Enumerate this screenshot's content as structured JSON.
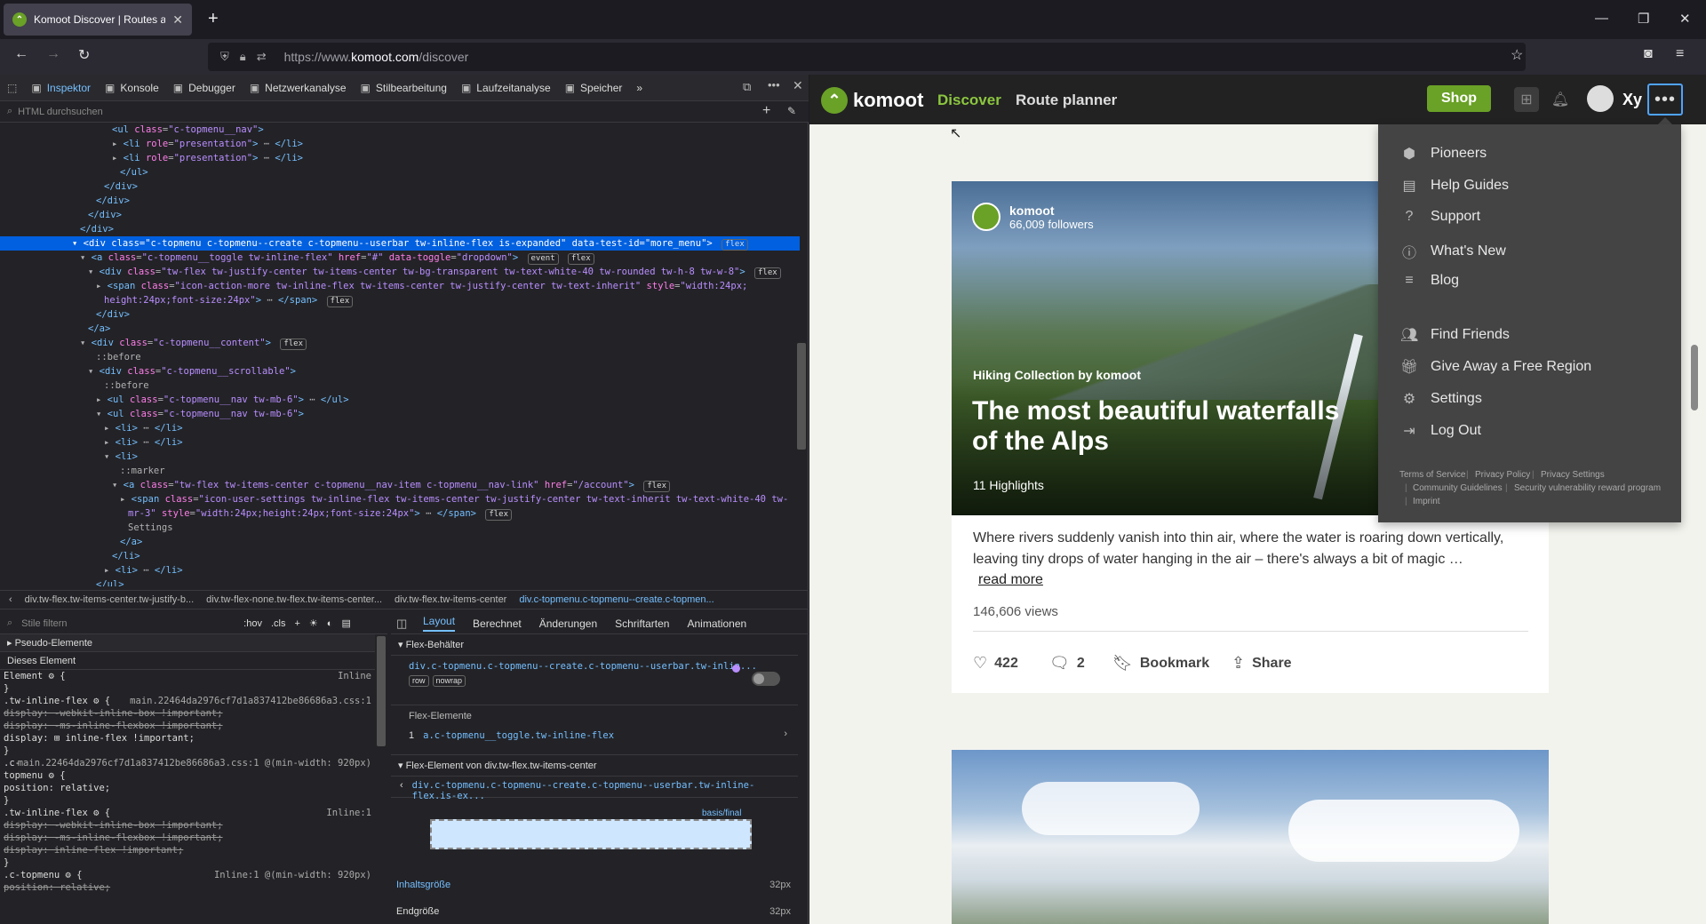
{
  "browser": {
    "tab_title": "Komoot Discover | Routes and M",
    "tab_close": "✕",
    "new_tab": "+",
    "url_prefix": "https://www.",
    "url_domain": "komoot.com",
    "url_path": "/discover",
    "window_controls": [
      "—",
      "❐",
      "✕"
    ]
  },
  "devtools": {
    "tabs": [
      {
        "label": "Inspektor",
        "icon": "inspector-icon",
        "active": true
      },
      {
        "label": "Konsole",
        "icon": "console-icon"
      },
      {
        "label": "Debugger",
        "icon": "debugger-icon"
      },
      {
        "label": "Netzwerkanalyse",
        "icon": "network-icon"
      },
      {
        "label": "Stilbearbeitung",
        "icon": "style-editor-icon"
      },
      {
        "label": "Laufzeitanalyse",
        "icon": "performance-icon"
      },
      {
        "label": "Speicher",
        "icon": "memory-icon"
      }
    ],
    "search_placeholder": "HTML durchsuchen",
    "markup_lines": [
      {
        "indent": 14,
        "html": "<span class='tg'>&lt;ul</span> <span class='an'>class</span>=<span class='av'>\"c-topmenu__nav\"</span><span class='tg'>&gt;</span>"
      },
      {
        "indent": 14,
        "html": "▸ <span class='tg'>&lt;li</span> <span class='an'>role</span>=<span class='av'>\"presentation\"</span><span class='tg'>&gt;</span> ⋯ <span class='tg'>&lt;/li&gt;</span>"
      },
      {
        "indent": 14,
        "html": "▸ <span class='tg'>&lt;li</span> <span class='an'>role</span>=<span class='av'>\"presentation\"</span><span class='tg'>&gt;</span> ⋯ <span class='tg'>&lt;/li&gt;</span>"
      },
      {
        "indent": 15,
        "html": "<span class='tg'>&lt;/ul&gt;</span>"
      },
      {
        "indent": 13,
        "html": "<span class='tg'>&lt;/div&gt;</span>"
      },
      {
        "indent": 12,
        "html": "<span class='tg'>&lt;/div&gt;</span>"
      },
      {
        "indent": 11,
        "html": "<span class='tg'>&lt;/div&gt;</span>"
      },
      {
        "indent": 10,
        "html": "<span class='tg'>&lt;/div&gt;</span>"
      },
      {
        "indent": 9,
        "sel": true,
        "html": "▾ <span class='tg'>&lt;div</span> <span class='an'>class</span>=<span class='av'>\"c-topmenu c-topmenu--create c-topmenu--userbar tw-inline-flex is-expanded\"</span> <span class='an'>data-test-id</span>=<span class='av'>\"more_menu\"</span><span class='tg'>&gt;</span> <span class='badge'>flex</span>"
      },
      {
        "indent": 10,
        "html": "▾ <span class='tg'>&lt;a</span> <span class='an'>class</span>=<span class='av'>\"c-topmenu__toggle tw-inline-flex\"</span> <span class='an'>href</span>=<span class='av'>\"#\"</span> <span class='an'>data-toggle</span>=<span class='av'>\"dropdown\"</span><span class='tg'>&gt;</span> <span class='badge'>event</span> <span class='badge'>flex</span>"
      },
      {
        "indent": 11,
        "html": "▾ <span class='tg'>&lt;div</span> <span class='an'>class</span>=<span class='av'>\"tw-flex tw-justify-center tw-items-center tw-bg-transparent tw-text-white-40 tw-rounded tw-h-8 tw-w-8\"</span><span class='tg'>&gt;</span> <span class='badge'>flex</span>"
      },
      {
        "indent": 12,
        "html": "▸ <span class='tg'>&lt;span</span> <span class='an'>class</span>=<span class='av'>\"icon-action-more tw-inline-flex tw-items-center tw-justify-center tw-text-inherit\"</span> <span class='an'>style</span>=<span class='av'>\"width:24px;</span>"
      },
      {
        "indent": 13,
        "html": "<span class='av'>height:24px;font-size:24px\"</span><span class='tg'>&gt;</span> ⋯ <span class='tg'>&lt;/span&gt;</span> <span class='badge'>flex</span>"
      },
      {
        "indent": 12,
        "html": "<span class='tg'>&lt;/div&gt;</span>"
      },
      {
        "indent": 11,
        "html": "<span class='tg'>&lt;/a&gt;</span>"
      },
      {
        "indent": 10,
        "html": "▾ <span class='tg'>&lt;div</span> <span class='an'>class</span>=<span class='av'>\"c-topmenu__content\"</span><span class='tg'>&gt;</span> <span class='badge'>flex</span>"
      },
      {
        "indent": 12,
        "html": "::before"
      },
      {
        "indent": 11,
        "html": "▾ <span class='tg'>&lt;div</span> <span class='an'>class</span>=<span class='av'>\"c-topmenu__scrollable\"</span><span class='tg'>&gt;</span>"
      },
      {
        "indent": 13,
        "html": "::before"
      },
      {
        "indent": 12,
        "html": "▸ <span class='tg'>&lt;ul</span> <span class='an'>class</span>=<span class='av'>\"c-topmenu__nav tw-mb-6\"</span><span class='tg'>&gt;</span> ⋯ <span class='tg'>&lt;/ul&gt;</span>"
      },
      {
        "indent": 12,
        "html": "▾ <span class='tg'>&lt;ul</span> <span class='an'>class</span>=<span class='av'>\"c-topmenu__nav tw-mb-6\"</span><span class='tg'>&gt;</span>"
      },
      {
        "indent": 13,
        "html": "▸ <span class='tg'>&lt;li&gt;</span> ⋯ <span class='tg'>&lt;/li&gt;</span>"
      },
      {
        "indent": 13,
        "html": "▸ <span class='tg'>&lt;li&gt;</span> ⋯ <span class='tg'>&lt;/li&gt;</span>"
      },
      {
        "indent": 13,
        "html": "▾ <span class='tg'>&lt;li&gt;</span>"
      },
      {
        "indent": 15,
        "html": "::marker"
      },
      {
        "indent": 14,
        "html": "▾ <span class='tg'>&lt;a</span> <span class='an'>class</span>=<span class='av'>\"tw-flex tw-items-center c-topmenu__nav-item c-topmenu__nav-link\"</span> <span class='an'>href</span>=<span class='av'>\"/account\"</span><span class='tg'>&gt;</span> <span class='badge'>flex</span>"
      },
      {
        "indent": 15,
        "html": "▸ <span class='tg'>&lt;span</span> <span class='an'>class</span>=<span class='av'>\"icon-user-settings tw-inline-flex tw-items-center tw-justify-center tw-text-inherit tw-text-white-40 tw-</span>"
      },
      {
        "indent": 16,
        "html": "<span class='av'>mr-3\"</span> <span class='an'>style</span>=<span class='av'>\"width:24px;height:24px;font-size:24px\"</span><span class='tg'>&gt;</span> ⋯ <span class='tg'>&lt;/span&gt;</span> <span class='badge'>flex</span>"
      },
      {
        "indent": 16,
        "html": "Settings"
      },
      {
        "indent": 15,
        "html": "<span class='tg'>&lt;/a&gt;</span>"
      },
      {
        "indent": 14,
        "html": "<span class='tg'>&lt;/li&gt;</span>"
      },
      {
        "indent": 13,
        "html": "▸ <span class='tg'>&lt;li&gt;</span> ⋯ <span class='tg'>&lt;/li&gt;</span>"
      },
      {
        "indent": 12,
        "html": "<span class='tg'>&lt;/ul&gt;</span>"
      }
    ],
    "breadcrumbs": [
      "div.tw-flex.tw-items-center.tw-justify-b...",
      "div.tw-flex-none.tw-flex.tw-items-center...",
      "div.tw-flex.tw-items-center",
      "div.c-topmenu.c-topmenu--create.c-topmen..."
    ],
    "rules_filter_placeholder": "Stile filtern",
    "rules_toggles": [
      ":hov",
      ".cls"
    ],
    "pseudo_elements": "Pseudo-Elemente",
    "this_element": "Dieses Element",
    "rules": [
      {
        "t": "Element ⚙ {",
        "src": "Inline"
      },
      {
        "t": "}"
      },
      {
        "t": ".tw-inline-flex ⚙ {",
        "src": "main.22464da2976cf7d1a837412be86686a3.css:1"
      },
      {
        "t": "  display: -webkit-inline-box !important;",
        "st": true
      },
      {
        "t": "  display: -ms-inline-flexbox !important;",
        "st": true
      },
      {
        "t": "  display: ⊞ inline-flex !important;"
      },
      {
        "t": "}"
      },
      {
        "t": ".c-",
        "src": "main.22464da2976cf7d1a837412be86686a3.css:1 @(min-width: 920px)"
      },
      {
        "t": "topmenu ⚙ {"
      },
      {
        "t": "  position: relative;"
      },
      {
        "t": "}"
      },
      {
        "t": ".tw-inline-flex ⚙ {",
        "src": "Inline:1"
      },
      {
        "t": "  display: -webkit-inline-box !important;",
        "st": true
      },
      {
        "t": "  display: -ms-inline-flexbox !important;",
        "st": true
      },
      {
        "t": "  display: inline-flex !important;",
        "st": true
      },
      {
        "t": "}"
      },
      {
        "t": ".c-topmenu ⚙ {",
        "src": "Inline:1 @(min-width: 920px)"
      },
      {
        "t": "  position: relative;",
        "st": true
      }
    ],
    "layout_tabs": [
      "Layout",
      "Berechnet",
      "Änderungen",
      "Schriftarten",
      "Animationen"
    ],
    "flex_container_title": "Flex-Behälter",
    "flex_container_selector": "div.c-topmenu.c-topmenu--create.c-topmenu--userbar.tw-inlin...",
    "flex_tags": [
      "row",
      "nowrap"
    ],
    "flex_items_title": "Flex-Elemente",
    "flex_item": "a.c-topmenu__toggle.tw-inline-flex",
    "flex_item_index": "1",
    "flex_item_of": "Flex-Element von div.tw-flex.tw-items-center",
    "flex_item_selector": "div.c-topmenu.c-topmenu--create.c-topmenu--userbar.tw-inline-flex.is-ex...",
    "basis_label": "basis/final",
    "content_size_label": "Inhaltsgröße",
    "content_size_value": "32px",
    "final_size_label": "Endgröße",
    "final_size_value": "32px"
  },
  "site": {
    "brand": "komoot",
    "nav": [
      "Discover",
      "Route planner"
    ],
    "shop": "Shop",
    "username": "Xy",
    "more_glyph": "•••",
    "card": {
      "author": "komoot",
      "followers": "66,009 followers",
      "collection": "Hiking Collection by komoot",
      "title": "The most beautiful waterfalls of the Alps",
      "highlights": "11 Highlights",
      "description": "Where rivers suddenly vanish into thin air, where the water is roaring down vertically, leaving tiny drops of water hanging in the air – there's always a bit of magic …",
      "read_more": "read more",
      "views": "146,606 views",
      "likes": "422",
      "comments": "2",
      "bookmark": "Bookmark",
      "share": "Share"
    },
    "menu": {
      "items": [
        "Pioneers",
        "Help Guides",
        "Support",
        "What's New",
        "Blog"
      ],
      "items2": [
        "Find Friends",
        "Give Away a Free Region",
        "Settings",
        "Log Out"
      ],
      "footer": [
        "Terms of Service",
        "Privacy Policy",
        "Privacy Settings",
        "Community Guidelines",
        "Security vulnerability reward program",
        "Imprint"
      ]
    }
  }
}
